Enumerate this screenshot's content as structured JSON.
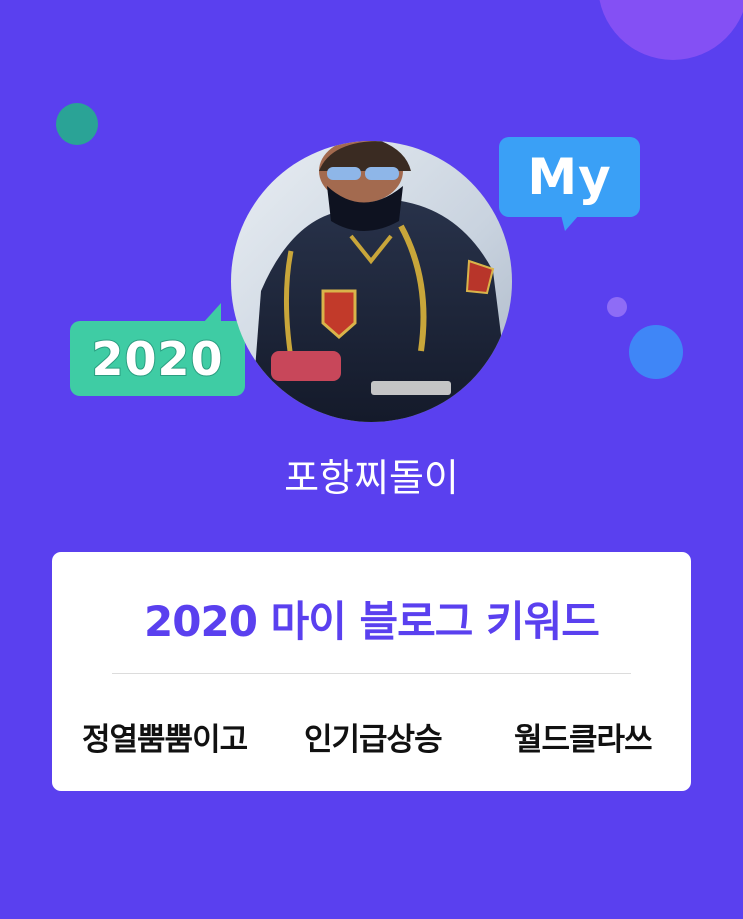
{
  "header": {
    "my_bubble": "My",
    "year_bubble": "2020"
  },
  "profile": {
    "avatar_icon": "profile-photo",
    "nickname": "포항찌돌이"
  },
  "keyword_card": {
    "title": "2020 마이 블로그 키워드",
    "keywords": [
      "정열뿜뿜이고",
      "인기급상승",
      "월드클라쓰"
    ]
  },
  "colors": {
    "background": "#5a40ef",
    "accent_title": "#5a40ef",
    "my_bubble": "#3aa0f6",
    "year_bubble": "#3fcca4",
    "card": "#ffffff",
    "keyword_text": "#111111"
  }
}
